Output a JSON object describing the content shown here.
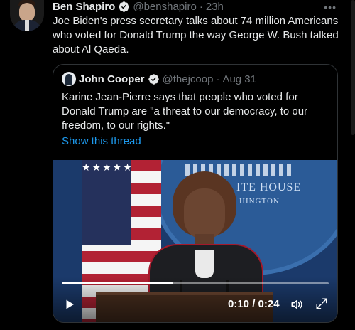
{
  "tweet": {
    "author_name": "Ben Shapiro",
    "handle": "@benshapiro",
    "separator": "·",
    "time": "23h",
    "more_icon": "more-horizontal-icon",
    "text": "Joe Biden's press secretary talks about 74 million Americans who voted for Donald Trump the way George W. Bush talked about Al Qaeda."
  },
  "quote": {
    "author_name": "John Cooper",
    "handle": "@thejcoop",
    "separator": "·",
    "date": "Aug 31",
    "text": "Karine Jean-Pierre says that people who voted for Donald Trump are \"a threat to our democracy, to our freedom, to our rights.\"",
    "show_thread": "Show this thread"
  },
  "video": {
    "backdrop_label_1": "ITE HOUSE",
    "backdrop_label_2": "HINGTON",
    "flag_stars": "★★★★★★★★★★★★★★★★★★★★★★★★★★★★★★★★★★★★",
    "elapsed": "0:10",
    "duration": "0:24",
    "time_display": "0:10 / 0:24",
    "progress": 0.4167
  },
  "colors": {
    "accent": "#1d9bf0",
    "verified": "#e7e9ea",
    "muted": "#71767b",
    "background": "#000000",
    "border": "#2f3336"
  }
}
